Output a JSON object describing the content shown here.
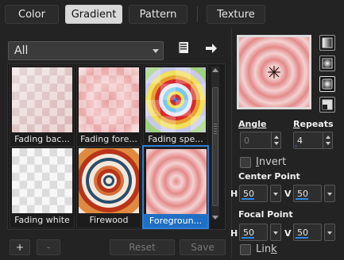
{
  "tabs": [
    {
      "label": "Color"
    },
    {
      "label": "Gradient"
    },
    {
      "label": "Pattern"
    },
    {
      "label": "Texture"
    }
  ],
  "active_tab": "Gradient",
  "category": {
    "value": "All"
  },
  "gallery": {
    "items": [
      {
        "label": "Fading bac..."
      },
      {
        "label": "Fading fore..."
      },
      {
        "label": "Fading spe..."
      },
      {
        "label": "Fading white"
      },
      {
        "label": "Firewood"
      },
      {
        "label": "Foregroun..."
      }
    ],
    "selected_index": 5
  },
  "buttons": {
    "add": "+",
    "remove": "-",
    "reset": "Reset",
    "save": "Save"
  },
  "controls": {
    "angle": {
      "label": "Angle",
      "value": "0",
      "enabled": false
    },
    "repeats": {
      "label_first": "R",
      "label_rest": "epeats",
      "value": "4",
      "fill": 0.04
    },
    "invert": {
      "label_first": "I",
      "label_rest": "nvert",
      "checked": false
    },
    "center_point": {
      "label": "Center Point",
      "h_label": "H",
      "h_value": "50",
      "v_label": "V",
      "v_value": "50",
      "h_fill": 0.5,
      "v_fill": 0.5
    },
    "focal_point": {
      "label": "Focal Point",
      "h_label": "H",
      "h_value": "50",
      "v_label": "V",
      "v_value": "50",
      "h_fill": 0.5,
      "v_fill": 0.5
    },
    "link": {
      "label_first": "Lin",
      "label_underline": "k",
      "checked": false
    }
  },
  "icons": {
    "library": "library-book-icon",
    "forward": "arrow-right-icon",
    "center_marker": "asterisk-marker-icon"
  },
  "colors": {
    "accent": "#2c7fd6",
    "gradient_light": "#f3d2d2",
    "gradient_dark": "#e48a8a"
  }
}
